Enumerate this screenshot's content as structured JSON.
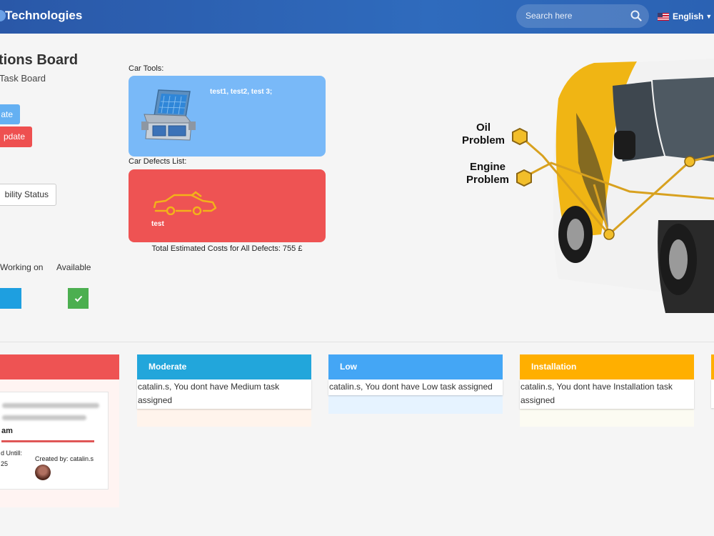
{
  "header": {
    "brand": "Technologies",
    "search_placeholder": "Search here",
    "language": "English"
  },
  "left": {
    "title": "tions Board",
    "subtitle": "Task Board",
    "btn_blue": "ate",
    "btn_red": "pdate",
    "btn_white": "bility Status",
    "legend_working": "Working on",
    "legend_available": "Available"
  },
  "tools": {
    "label": "Car Tools:",
    "items": "test1, test2, test 3;"
  },
  "defects": {
    "label": "Car Defects List:",
    "item": "test",
    "total": "Total Estimated Costs for All Defects: 755 £"
  },
  "van": {
    "oil_line1": "Oil",
    "oil_line2": "Problem",
    "engine_line1": "Engine",
    "engine_line2": "Problem"
  },
  "columns": [
    {
      "label": "",
      "color": "#ee5353"
    },
    {
      "label": "Moderate",
      "color": "#22a6db",
      "message": "catalin.s, You dont have Medium task assigned",
      "bg": "#fff4ec"
    },
    {
      "label": "Low",
      "color": "#44a6f5",
      "message": "catalin.s, You dont have Low task assigned",
      "bg": "#e6f3ff"
    },
    {
      "label": "Installation",
      "color": "#ffaf00",
      "message": "catalin.s, You dont have Installation task assigned",
      "bg": "#fcfbf2"
    }
  ],
  "task": {
    "name": "am",
    "until_label": "d Untill:",
    "date": "25",
    "created_by": "Created by: catalin.s"
  }
}
